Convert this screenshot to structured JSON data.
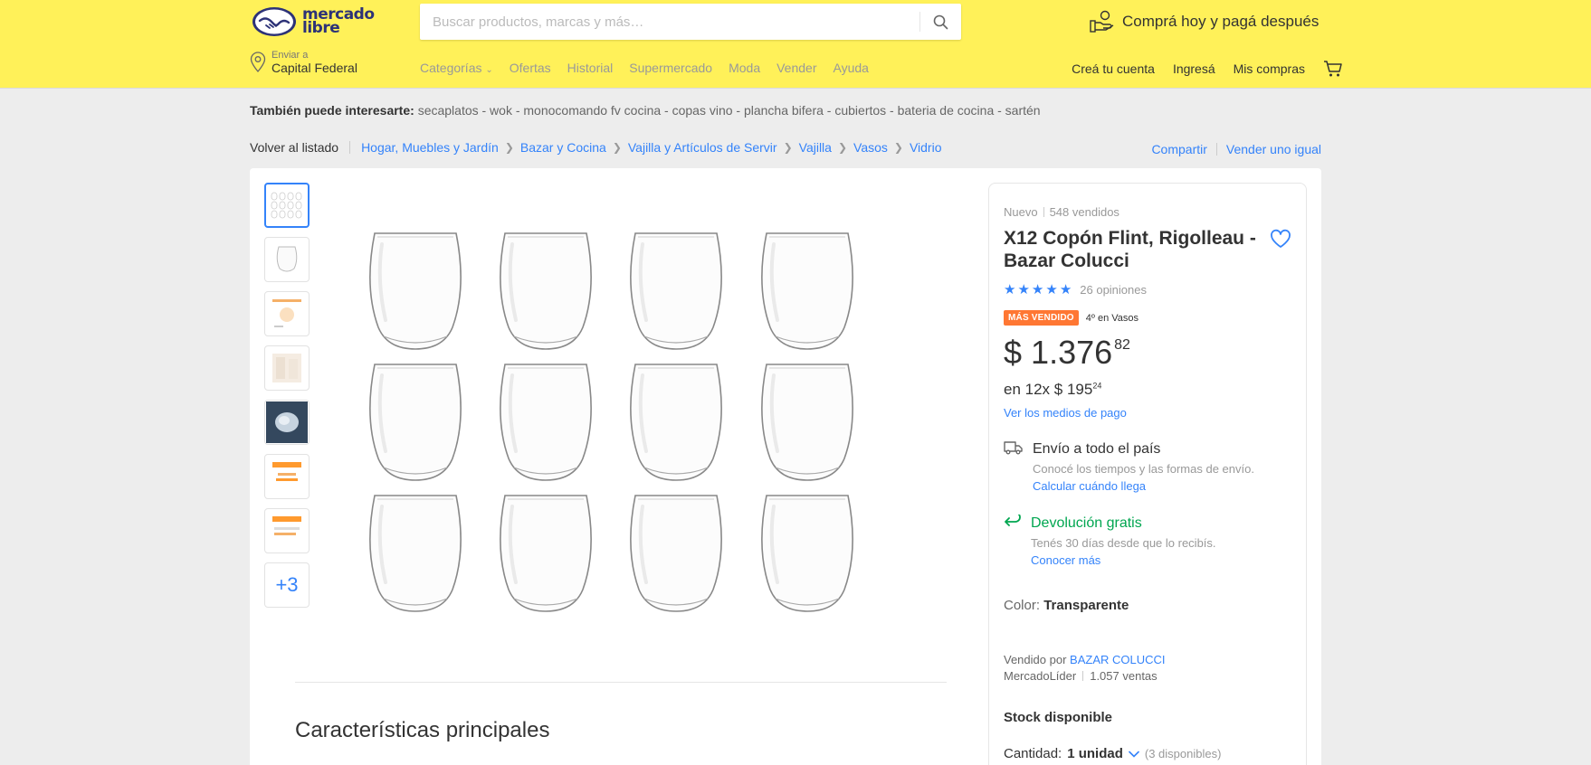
{
  "header": {
    "logo_text_line1": "mercado",
    "logo_text_line2": "libre",
    "search_placeholder": "Buscar productos, marcas y más…",
    "promo": "Comprá hoy y pagá después",
    "location_label": "Enviar a",
    "location_value": "Capital Federal",
    "nav": [
      "Categorías",
      "Ofertas",
      "Historial",
      "Supermercado",
      "Moda",
      "Vender",
      "Ayuda"
    ],
    "account": [
      "Creá tu cuenta",
      "Ingresá",
      "Mis compras"
    ]
  },
  "related": {
    "label": "También puede interesarte:",
    "items": "secaplatos - wok - monocomando fv cocina - copas vino - plancha bifera - cubiertos - bateria de cocina - sartén"
  },
  "breadcrumb": {
    "back": "Volver al listado",
    "items": [
      "Hogar, Muebles y Jardín",
      "Bazar y Cocina",
      "Vajilla y Artículos de Servir",
      "Vajilla",
      "Vasos",
      "Vidrio"
    ],
    "share": "Compartir",
    "sell": "Vender uno igual"
  },
  "gallery": {
    "more_label": "+3"
  },
  "product": {
    "condition": "Nuevo",
    "sold": "548 vendidos",
    "title": "X12 Copón Flint, Rigolleau - Bazar Colucci",
    "rating_count": "26 opiniones",
    "badge": "MÁS VENDIDO",
    "badge_rank": "4º en Vasos",
    "price_currency": "$",
    "price_int": "1.376",
    "price_cents": "82",
    "installments_prefix": "en 12x $ 195",
    "installments_cents": "24",
    "payment_link": "Ver los medios de pago",
    "shipping_title": "Envío a todo el país",
    "shipping_sub": "Conocé los tiempos y las formas de envío.",
    "shipping_link": "Calcular cuándo llega",
    "return_title": "Devolución gratis",
    "return_sub": "Tenés 30 días desde que lo recibís.",
    "return_link": "Conocer más",
    "color_label": "Color:",
    "color_value": "Transparente",
    "seller_prefix": "Vendido por",
    "seller_name": "BAZAR COLUCCI",
    "seller_level": "MercadoLíder",
    "seller_sales": "1.057 ventas",
    "stock": "Stock disponible",
    "qty_label": "Cantidad:",
    "qty_value": "1 unidad",
    "qty_available": "(3 disponibles)"
  },
  "features": {
    "title": "Características principales"
  },
  "colors": {
    "header_bg": "#fff159",
    "link": "#3483fa",
    "success": "#00a650",
    "badge": "#ff7733"
  }
}
